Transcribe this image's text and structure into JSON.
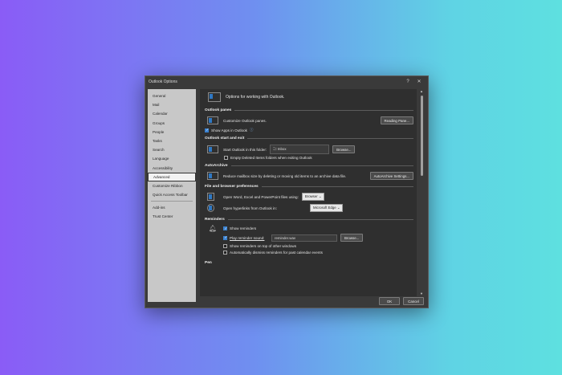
{
  "window": {
    "title": "Outlook Options",
    "help_label": "?",
    "close_label": "✕"
  },
  "sidebar": {
    "items": [
      {
        "label": "General"
      },
      {
        "label": "Mail"
      },
      {
        "label": "Calendar"
      },
      {
        "label": "Groups"
      },
      {
        "label": "People"
      },
      {
        "label": "Tasks"
      },
      {
        "label": "Search"
      },
      {
        "label": "Language"
      },
      {
        "label": "Accessibility"
      },
      {
        "label": "Advanced",
        "selected": true
      },
      {
        "label": "Customize Ribbon"
      },
      {
        "label": "Quick Access Toolbar"
      },
      {
        "label": "Add-ins"
      },
      {
        "label": "Trust Center"
      }
    ]
  },
  "content": {
    "header": "Options for working with Outlook.",
    "panes": {
      "title": "Outlook panes",
      "customize_label": "Customize Outlook panes.",
      "reading_pane_button": "Reading Pane...",
      "show_apps_label": "Show Apps in Outlook",
      "show_apps_checked": true
    },
    "start_exit": {
      "title": "Outlook start and exit",
      "start_label": "Start Outlook in this folder:",
      "folder_value": "Inbox",
      "browse_button": "Browse...",
      "empty_deleted_label": "Empty Deleted Items folders when exiting Outlook",
      "empty_deleted_checked": false
    },
    "autoarchive": {
      "title": "AutoArchive",
      "desc": "Reduce mailbox size by deleting or moving old items to an archive data file.",
      "button": "AutoArchive Settings..."
    },
    "browser": {
      "title": "File and browser preferences",
      "open_files_label": "Open Word, Excel and PowerPoint files using:",
      "open_files_value": "Browser",
      "open_links_label": "Open hyperlinks from Outlook in:",
      "open_links_value": "Microsoft Edge"
    },
    "reminders": {
      "title": "Reminders",
      "show_reminders_label": "Show reminders",
      "show_reminders_checked": true,
      "play_sound_label": "Play reminder sound:",
      "play_sound_checked": true,
      "sound_file": "reminder.wav",
      "browse_button": "Browse...",
      "on_top_label": "Show reminders on top of other windows",
      "on_top_checked": false,
      "dismiss_label": "Automatically dismiss reminders for past calendar events",
      "dismiss_checked": false
    },
    "pen": {
      "title": "Pen"
    }
  },
  "footer": {
    "ok": "OK",
    "cancel": "Cancel"
  },
  "colors": {
    "accent": "#3b82d0",
    "dialog_bg": "#3a3a3a",
    "sidebar_bg": "#c8c8c8"
  }
}
